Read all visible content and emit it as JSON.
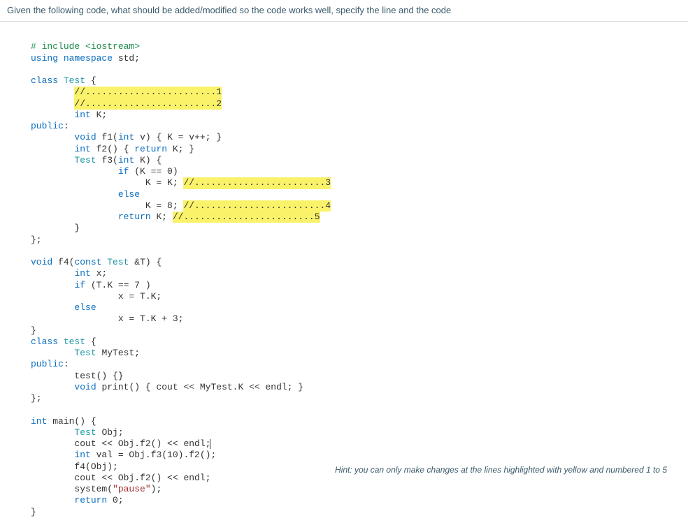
{
  "header": {
    "question": "Given the following code, what should be added/modified so the code works well, specify the line and the code"
  },
  "hint": {
    "text": "Hint: you can only make changes at the lines highlighted with yellow and numbered 1 to 5"
  },
  "code": {
    "include_prefix": "# ",
    "include_kw": "include",
    "include_hdr": " <iostream>",
    "using_kw": "using",
    "namespace_kw": " namespace",
    "std_id": " std;",
    "class_kw": "class",
    "Test_name": " Test",
    "open_brace": " {",
    "hl1_prefix": "//",
    "hl1_dots": "........................1",
    "hl2_prefix": "//",
    "hl2_dots": "........................2",
    "int_kw": "int",
    "K_decl": " K;",
    "public_kw": "public",
    "colon": ":",
    "void_kw": "void",
    "f1_sig": " f1(",
    "f1_param_t": "int",
    "f1_param_n": " v) { K = v++; }",
    "f2_sig": " f2() { ",
    "return_kw": "return",
    "f2_body": " K; }",
    "Test_type": "Test",
    "f3_sig": " f3(",
    "f3_param_t": "int",
    "f3_param_n": " K) {",
    "if_kw": "if",
    "f3_if_cond": " (K == 0)",
    "f3_assign1": "K = K; ",
    "hl3_prefix": "//",
    "hl3_dots": "........................3",
    "else_kw": "else",
    "f3_assign2": "K = 8; ",
    "hl4_prefix": "//",
    "hl4_dots": "........................4",
    "f3_ret_pre": "return",
    "f3_ret_post": " K; ",
    "hl5_prefix": "//",
    "hl5_dots": "........................5",
    "close_brace_inner": "}",
    "close_class": "};",
    "f4_sig1": " f4(",
    "const_kw": "const",
    "f4_sig2": " Test",
    "f4_sig3": " &T) {",
    "x_decl": " x;",
    "f4_if_cond": " (T.K == 7 )",
    "f4_assign1": "x = T.K;",
    "f4_assign2": "x = T.K + 3;",
    "close_f4": "}",
    "class_kw2": "class",
    "test_name": " test",
    "open_brace2": " {",
    "MyTest_decl_t": "Test",
    "MyTest_decl_n": " MyTest;",
    "public_kw2": "public",
    "test_ctor": "test() {}",
    "print_sig1": " print() { cout << MyTest.K << endl; }",
    "close_class2": "};",
    "main_sig_t": "int",
    "main_sig_n": " main() {",
    "Obj_decl_t": "Test",
    "Obj_decl_n": " Obj;",
    "main_l2a": "cout << Obj.f2() << endl;",
    "main_l3a": "int",
    "main_l3b": " val = Obj.f3(10).f2();",
    "main_l4": "f4(Obj);",
    "main_l5": "cout << Obj.f2() << endl;",
    "system_call": "system(",
    "pause_str": "\"pause\"",
    "system_close": ");",
    "return0_kw": "return",
    "return0_val": " 0;",
    "close_main": "}"
  }
}
